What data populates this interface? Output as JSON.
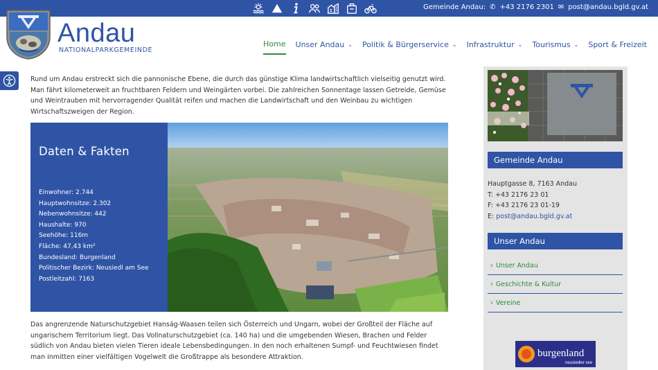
{
  "topbar": {
    "icons": [
      "sun-water-icon",
      "tent-icon",
      "info-icon",
      "people-icon",
      "buildings-icon",
      "bag-icon",
      "bicycle-icon"
    ],
    "contact_label": "Gemeinde Andau:",
    "phone": "+43 2176 2301",
    "email": "post@andau.bgld.gv.at"
  },
  "brand": {
    "title": "Andau",
    "subtitle": "NATIONALPARKGEMEINDE"
  },
  "nav": {
    "items": [
      {
        "label": "Home",
        "active": true,
        "dropdown": false
      },
      {
        "label": "Unser Andau",
        "dropdown": true
      },
      {
        "label": "Politik & Bürgerservice",
        "dropdown": true
      },
      {
        "label": "Infrastruktur",
        "dropdown": true
      },
      {
        "label": "Tourismus",
        "dropdown": true
      },
      {
        "label": "Sport & Freizeit",
        "dropdown": false
      }
    ]
  },
  "main": {
    "intro": "Rund um Andau erstreckt sich die pannonische Ebene, die durch das günstige Klima landwirtschaftlich vielseitig genutzt wird. Man fährt kilometerweit an fruchtbaren Feldern und Weingärten vorbei. Die zahlreichen Sonnentage lassen Getreide, Gemüse und Weintrauben mit hervorragender Qualität reifen und machen die Landwirtschaft und den Weinbau zu wichtigen Wirtschaftszweigen der Region.",
    "facts": {
      "title": "Daten & Fakten",
      "items": [
        "Einwohner: 2.744",
        "Hauptwohnsitze: 2.302",
        "Nebenwohnsitze: 442",
        "Haushalte: 970",
        "Seehöhe: 116m",
        "Fläche: 47,43 km²",
        "Bundesland: Burgenland",
        "Politischer Bezirk: Neusiedl am See",
        "Postleitzahl: 7163"
      ]
    },
    "outro": "Das angrenzende Naturschutzgebiet Hanság-Waasen teilen sich Österreich und Ungarn, wobei der Großteil der Fläche auf ungarischem Territorium liegt. Das Vollnaturschutzgebiet (ca. 140 ha) und die umgebenden Wiesen, Brachen und Felder südlich von Andau bieten vielen Tieren ideale Lebensbedingungen. In den noch erhaltenen Sumpf- und Feuchtwiesen findet man inmitten einer vielfältigen Vogelwelt die Großtrappe als besondere Attraktion."
  },
  "sidebar": {
    "gemeinde_heading": "Gemeinde Andau",
    "address": "Hauptgasse 8, 7163 Andau",
    "phone": "T: +43 2176 23 01",
    "fax": "F: +43 2176 23 01-19",
    "email_prefix": "E:",
    "email": "post@andau.bgld.gv.at",
    "unser_heading": "Unser Andau",
    "links": [
      "Unser Andau",
      "Geschichte & Kultur",
      "Vereine"
    ],
    "banner": {
      "brand": "burgenland",
      "sub": "neusiedler see"
    }
  },
  "colors": {
    "primary": "#2f54a5",
    "accent": "#2c8a3e",
    "sidebar_bg": "#e4e4e4"
  }
}
